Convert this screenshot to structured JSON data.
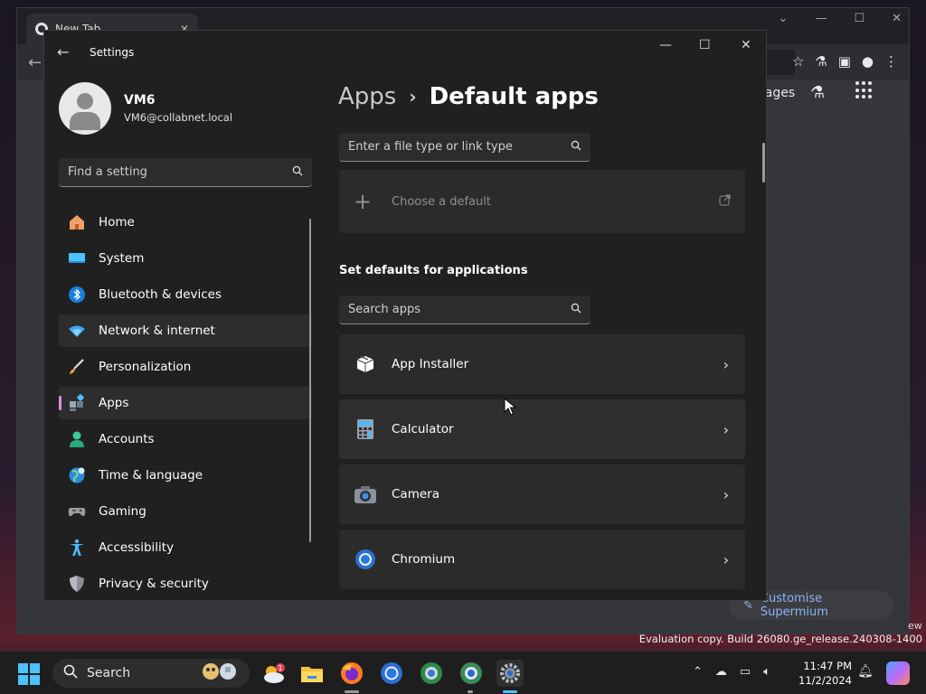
{
  "browser": {
    "tab_title": "New Tab",
    "tab_close": "✕",
    "images_link": "Images",
    "customise_label": "Customise Supermium"
  },
  "settings": {
    "window_title": "Settings",
    "profile": {
      "name": "VM6",
      "email": "VM6@collabnet.local"
    },
    "find_placeholder": "Find a setting",
    "nav": [
      {
        "label": "Home",
        "icon": "home-icon"
      },
      {
        "label": "System",
        "icon": "system-icon"
      },
      {
        "label": "Bluetooth & devices",
        "icon": "bluetooth-icon"
      },
      {
        "label": "Network & internet",
        "icon": "network-icon"
      },
      {
        "label": "Personalization",
        "icon": "brush-icon"
      },
      {
        "label": "Apps",
        "icon": "apps-icon",
        "selected": true
      },
      {
        "label": "Accounts",
        "icon": "accounts-icon"
      },
      {
        "label": "Time & language",
        "icon": "globe-icon"
      },
      {
        "label": "Gaming",
        "icon": "gamepad-icon"
      },
      {
        "label": "Accessibility",
        "icon": "accessibility-icon"
      },
      {
        "label": "Privacy & security",
        "icon": "shield-icon"
      }
    ],
    "breadcrumb": {
      "parent": "Apps",
      "separator": "›",
      "current": "Default apps"
    },
    "filetype_placeholder": "Enter a file type or link type",
    "choose_default": "Choose a default",
    "section_title": "Set defaults for applications",
    "search_apps_placeholder": "Search apps",
    "apps": [
      {
        "name": "App Installer",
        "icon": "package-icon"
      },
      {
        "name": "Calculator",
        "icon": "calculator-icon"
      },
      {
        "name": "Camera",
        "icon": "camera-icon"
      },
      {
        "name": "Chromium",
        "icon": "chromium-icon"
      }
    ]
  },
  "system": {
    "eval_text": "Evaluation copy. Build 26080.ge_release.240308-1400",
    "edge_text": "ew"
  },
  "taskbar": {
    "search_label": "Search",
    "weather_badge": "1",
    "time": "11:47 PM",
    "date": "11/2/2024"
  },
  "colors": {
    "accent": "#4cc2ff",
    "selection": "#d88fd8",
    "window_bg": "#202020",
    "card_bg": "#2b2b2b"
  }
}
